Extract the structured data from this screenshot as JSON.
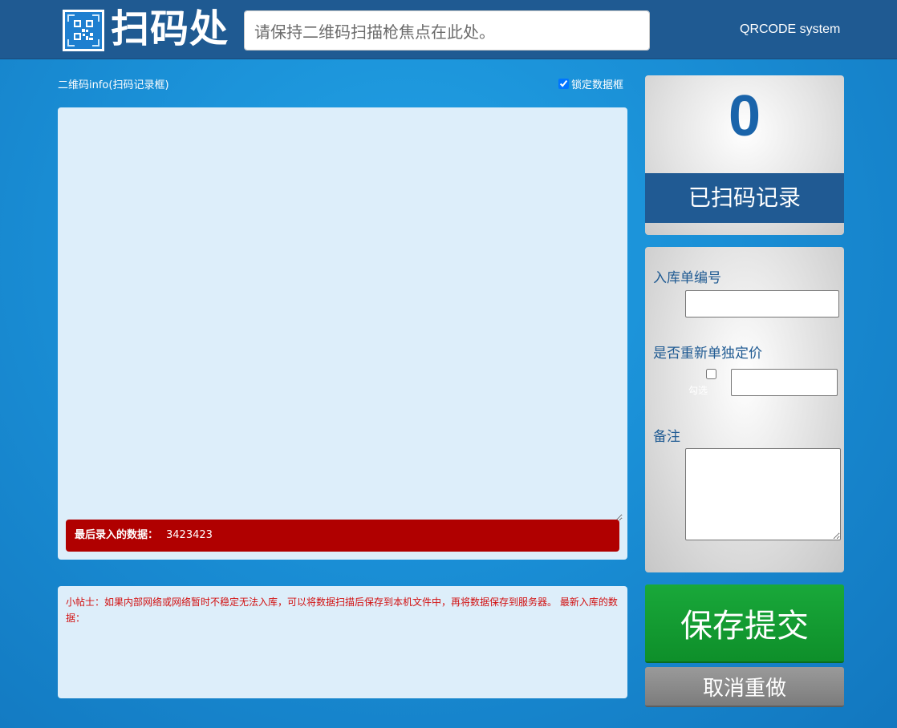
{
  "header": {
    "logo_text": "扫码处",
    "scan_placeholder": "请保持二维码扫描枪焦点在此处。",
    "system_name": "QRCODE system"
  },
  "record": {
    "title": "二维码info(扫码记录框)",
    "lock_label": "锁定数据框",
    "lock_checked": true,
    "last_label": "最后录入的数据：",
    "last_value": "3423423"
  },
  "tip": {
    "text": "小帖士：如果内部网络或网络暂时不稳定无法入库，可以将数据扫描后保存到本机文件中，再将数据保存到服务器。 最新入库的数据："
  },
  "counter": {
    "count": "0",
    "label": "已扫码记录"
  },
  "form": {
    "order_label": "入库单编号",
    "reprice_label": "是否重新单独定价",
    "check_label": "勾选",
    "note_label": "备注"
  },
  "actions": {
    "save_label": "保存提交",
    "cancel_label": "取消重做"
  },
  "colors": {
    "header_bg": "#1f5a92",
    "accent_blue": "#1a64aa",
    "alert_red": "#b00000",
    "save_green": "#0e8f2a",
    "cancel_gray": "#7c7c7c"
  }
}
